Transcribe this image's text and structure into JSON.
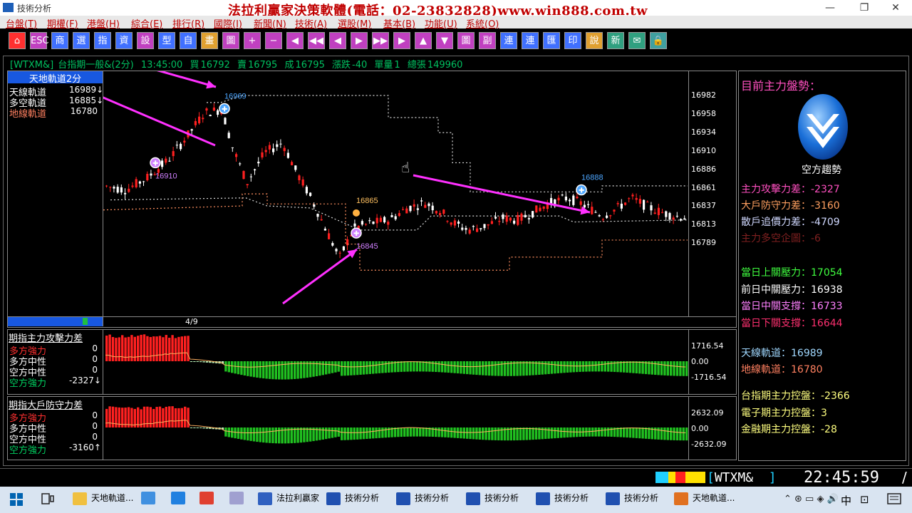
{
  "window": {
    "title": "技術分析",
    "banner": "法拉利贏家決策軟體(電話：02-23832828)www.win888.com.tw",
    "minimize": "—",
    "restore": "❐",
    "close": "✕"
  },
  "menu": [
    "台盤(T)",
    "期權(F)",
    "港盤(H)",
    "綜合(E)",
    "排行(R)",
    "國際(I)",
    "新聞(N)",
    "技術(A)",
    "選股(M)",
    "基本(B)",
    "功能(U)",
    "系統(O)"
  ],
  "toolbar": [
    {
      "label": "⌂",
      "color": "#ff3030",
      "icon": "home-icon"
    },
    {
      "label": "ESC",
      "color": "#c040c0",
      "icon": "escape-icon"
    },
    {
      "label": "商",
      "color": "#4070ff",
      "icon": "product-icon"
    },
    {
      "label": "選",
      "color": "#4070ff",
      "icon": "select-icon"
    },
    {
      "label": "指",
      "color": "#4070ff",
      "icon": "index-icon"
    },
    {
      "label": "資",
      "color": "#4070ff",
      "icon": "data-icon"
    },
    {
      "label": "設",
      "color": "#c040c0",
      "icon": "settings-icon"
    },
    {
      "label": "型",
      "color": "#4070ff",
      "icon": "pattern-icon"
    },
    {
      "label": "自",
      "color": "#4070ff",
      "icon": "custom-icon"
    },
    {
      "label": "畫",
      "color": "#e0a030",
      "icon": "draw-icon"
    },
    {
      "label": "圖",
      "color": "#c040c0",
      "icon": "chart-icon"
    },
    {
      "label": "+",
      "color": "#c040c0",
      "icon": "zoom-in-icon"
    },
    {
      "label": "−",
      "color": "#c040c0",
      "icon": "zoom-out-icon"
    },
    {
      "label": "◀",
      "color": "#c040c0",
      "icon": "left-icon"
    },
    {
      "label": "◀◀",
      "color": "#c040c0",
      "icon": "fast-left-icon"
    },
    {
      "label": "◀",
      "color": "#c040c0",
      "icon": "step-left-icon"
    },
    {
      "label": "▶",
      "color": "#c040c0",
      "icon": "step-right-icon"
    },
    {
      "label": "▶▶",
      "color": "#c040c0",
      "icon": "fast-right-icon"
    },
    {
      "label": "▶",
      "color": "#c040c0",
      "icon": "right-icon"
    },
    {
      "label": "▲",
      "color": "#c040c0",
      "icon": "up-icon"
    },
    {
      "label": "▼",
      "color": "#c040c0",
      "icon": "down-icon"
    },
    {
      "label": "圖",
      "color": "#c040c0",
      "icon": "graph-icon"
    },
    {
      "label": "副",
      "color": "#c040c0",
      "icon": "sub-icon"
    },
    {
      "label": "連",
      "color": "#4070ff",
      "icon": "link-icon"
    },
    {
      "label": "連",
      "color": "#4070ff",
      "icon": "link2-icon"
    },
    {
      "label": "匯",
      "color": "#4070ff",
      "icon": "export-icon"
    },
    {
      "label": "印",
      "color": "#4070ff",
      "icon": "print-icon"
    },
    {
      "label": "說",
      "color": "#e0a030",
      "icon": "help-icon"
    },
    {
      "label": "新",
      "color": "#30a080",
      "icon": "new-icon"
    },
    {
      "label": "✉",
      "color": "#30a080",
      "icon": "mail-icon"
    },
    {
      "label": "🔒",
      "color": "#40a0a0",
      "icon": "lock-icon"
    }
  ],
  "quote": {
    "symbol": "[WTXM&]",
    "name": "台指期一般&(2分)",
    "time": "13:45:00",
    "bid_label": "買",
    "bid": "16792",
    "ask_label": "賣",
    "ask": "16795",
    "deal_label": "成",
    "deal": "16795",
    "chg_label": "漲跌",
    "chg": "-40",
    "vol_label": "單量",
    "vol": "1",
    "total_label": "總張",
    "total": "149960"
  },
  "main_panel": {
    "title": "天地軌道2分",
    "legend": [
      {
        "label": "天線軌道",
        "value": "16989",
        "color": "#ffffff",
        "arrow": "↓"
      },
      {
        "label": "多空軌道",
        "value": "16885",
        "color": "#ffffff",
        "arrow": "↓"
      },
      {
        "label": "地線軌道",
        "value": "16780",
        "color": "#ff8060",
        "arrow": ""
      }
    ],
    "date": "4/9",
    "y_ticks": [
      "16982",
      "16958",
      "16934",
      "16910",
      "16886",
      "16861",
      "16837",
      "16813",
      "16789"
    ],
    "annotations": [
      {
        "text": "16969",
        "color": "#4da6ff"
      },
      {
        "text": "16910",
        "color": "#d080ff"
      },
      {
        "text": "16865",
        "color": "#ffc060"
      },
      {
        "text": "16845",
        "color": "#d080ff"
      },
      {
        "text": "16888",
        "color": "#4da6ff"
      }
    ]
  },
  "sub_panel1": {
    "title": "期指主力攻擊力差",
    "legend": [
      {
        "label": "多方強力",
        "value": "0",
        "color": "#ff3030"
      },
      {
        "label": "多方中性",
        "value": "0",
        "color": "#ffffff"
      },
      {
        "label": "空方中性",
        "value": "0",
        "color": "#ffffff"
      },
      {
        "label": "空方強力",
        "value": "-2327",
        "color": "#00d060",
        "arrow": "↓"
      }
    ],
    "y_ticks": [
      "1716.54",
      "0.00",
      "-1716.54"
    ]
  },
  "sub_panel2": {
    "title": "期指大戶防守力差",
    "legend": [
      {
        "label": "多方強力",
        "value": "0",
        "color": "#ff3030"
      },
      {
        "label": "多方中性",
        "value": "0",
        "color": "#ffffff"
      },
      {
        "label": "空方中性",
        "value": "0",
        "color": "#ffffff"
      },
      {
        "label": "空方強力",
        "value": "-3160",
        "color": "#00d060",
        "arrow": "↑"
      }
    ],
    "y_ticks": [
      "2632.09",
      "0.00",
      "-2632.09"
    ]
  },
  "right_panel": {
    "title": "目前主力盤勢：",
    "trend_label": "空方趨勢",
    "stats1": [
      {
        "label": "主力攻擊力差",
        "value": "-2327",
        "color": "#ff50c0"
      },
      {
        "label": "大戶防守力差",
        "value": "-3160",
        "color": "#ffa060"
      },
      {
        "label": "散戶追價力差",
        "value": "-4709",
        "color": "#d0d8ff"
      },
      {
        "label": "主力多空企圖",
        "value": "-6",
        "color": "#802020"
      }
    ],
    "stats2": [
      {
        "label": "當日上關壓力",
        "value": "17054",
        "color": "#40ff40"
      },
      {
        "label": "前日中關壓力",
        "value": "16938",
        "color": "#ffffff"
      },
      {
        "label": "當日中關支撐",
        "value": "16733",
        "color": "#ff80ff"
      },
      {
        "label": "當日下關支撐",
        "value": "16644",
        "color": "#ff3070"
      }
    ],
    "stats3": [
      {
        "label": "天線軌道",
        "value": "16989",
        "color": "#a0d8ff"
      },
      {
        "label": "地線軌道",
        "value": "16780",
        "color": "#ff8060"
      }
    ],
    "stats4": [
      {
        "label": "台指期主力控盤",
        "value": "-2366",
        "color": "#ffff80"
      },
      {
        "label": "電子期主力控盤",
        "value": "3",
        "color": "#ffff80"
      },
      {
        "label": "金融期主力控盤",
        "value": "-28",
        "color": "#ffff80"
      }
    ]
  },
  "status": {
    "symbol": "WTXM&",
    "clock": "22:45:59"
  },
  "taskbar": [
    {
      "label": "天地軌道...",
      "color": "#f0c040"
    },
    {
      "label": "",
      "color": "#4090e0"
    },
    {
      "label": "",
      "color": "#2080e0"
    },
    {
      "label": "",
      "color": "#e04030"
    },
    {
      "label": "",
      "color": "#a0a0d0"
    },
    {
      "label": "法拉利贏家",
      "color": "#3060c0"
    },
    {
      "label": "技術分析",
      "color": "#2050b0"
    },
    {
      "label": "技術分析",
      "color": "#2050b0"
    },
    {
      "label": "技術分析",
      "color": "#2050b0"
    },
    {
      "label": "技術分析",
      "color": "#2050b0"
    },
    {
      "label": "技術分析",
      "color": "#2050b0"
    },
    {
      "label": "天地軌道...",
      "color": "#e07020"
    }
  ],
  "tray": {
    "lang": "中",
    "ime": "⊡"
  }
}
